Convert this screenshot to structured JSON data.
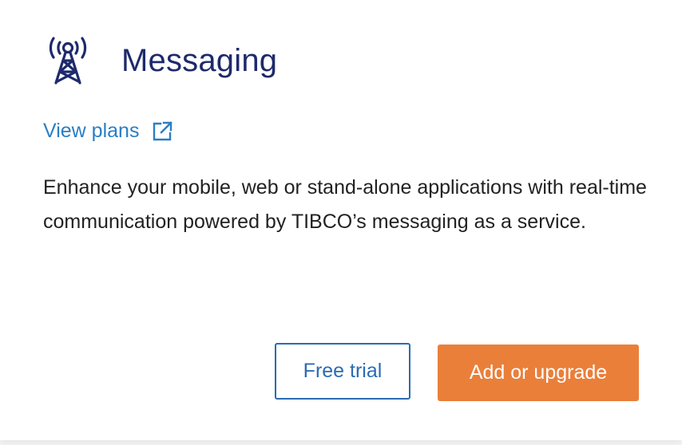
{
  "card": {
    "icon": "radio-tower-icon",
    "title": "Messaging",
    "view_plans_label": "View plans",
    "external_link_icon": "external-link-icon",
    "description": "Enhance your mobile, web or stand-alone applications with real-time communication powered by TIBCO’s messaging as a service.",
    "free_trial_label": "Free trial",
    "add_or_upgrade_label": "Add or upgrade"
  },
  "colors": {
    "title": "#1e2a6b",
    "link": "#2b7ec4",
    "outline_button": "#2b6bb3",
    "primary_button": "#ea7f3a",
    "body_text": "#222222",
    "background": "#ffffff"
  }
}
